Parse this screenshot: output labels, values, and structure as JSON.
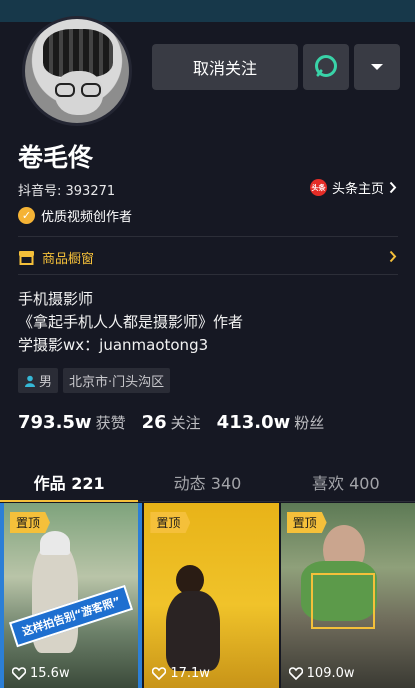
{
  "header": {
    "unfollow_label": "取消关注"
  },
  "profile": {
    "name": "卷毛佟",
    "douyin_id": "抖音号: 393271",
    "toutiao_logo": "头条",
    "toutiao_label": "头条主页",
    "creator_badge": "优质视频创作者"
  },
  "shop": {
    "label": "商品橱窗"
  },
  "bio": {
    "line1": "手机摄影师",
    "line2": "《拿起手机人人都是摄影师》作者",
    "line3": "学摄影wx：juanmaotong3"
  },
  "tags": {
    "gender": "男",
    "location": "北京市·门头沟区"
  },
  "stats": [
    {
      "value": "793.5w",
      "label": "获赞"
    },
    {
      "value": "26",
      "label": "关注"
    },
    {
      "value": "413.0w",
      "label": "粉丝"
    }
  ],
  "tabs": [
    {
      "label": "作品 221",
      "active": true
    },
    {
      "label": "动态 340",
      "active": false
    },
    {
      "label": "喜欢 400",
      "active": false
    }
  ],
  "videos": [
    {
      "pinned": "置顶",
      "likes": "15.6w",
      "banner": "这样拍告别“游客照”"
    },
    {
      "pinned": "置顶",
      "likes": "17.1w"
    },
    {
      "pinned": "置顶",
      "likes": "109.0w"
    }
  ],
  "colors": {
    "background": "#161823",
    "accent": "#f5c03a",
    "button": "#393b44",
    "chat_icon": "#39d3a8"
  },
  "icons": [
    "chat-bubble-icon",
    "caret-down-icon",
    "chevron-right-icon",
    "check-icon",
    "shop-icon",
    "person-icon",
    "heart-icon"
  ]
}
